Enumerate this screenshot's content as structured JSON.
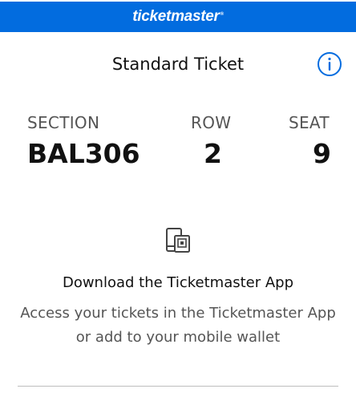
{
  "header": {
    "brand": "ticketmaster",
    "brand_mark": "®",
    "background_color": "#026cdf"
  },
  "ticket": {
    "type": "Standard Ticket",
    "info_icon": "info-circle-icon",
    "section_label": "SECTION",
    "section_value": "BAL306",
    "row_label": "ROW",
    "row_value": "2",
    "seat_label": "SEAT",
    "seat_value": "9"
  },
  "app_promo": {
    "icon": "mobile-ticket-icon",
    "title": "Download the Ticketmaster App",
    "description": "Access your tickets in the Ticketmaster App or add to your mobile wallet"
  }
}
